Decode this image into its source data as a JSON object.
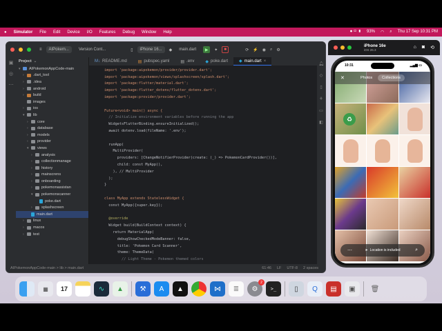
{
  "menubar": {
    "apple": "",
    "items": [
      "Simulator",
      "File",
      "Edit",
      "Device",
      "I/O",
      "Features",
      "Debug",
      "Window",
      "Help"
    ],
    "battery": "93%",
    "clock": "Thu 17 Sep 10:31 PM"
  },
  "ide": {
    "project_name": "AIPokem...",
    "vcs": "Version Cont...",
    "device": "iPhone 16...",
    "run_config": "main.dart",
    "tabs": [
      "README.md",
      "pubspec.yaml",
      ".env",
      "poke.dart",
      "main.dart"
    ],
    "project_label": "Project",
    "tree": [
      {
        "label": "AIPokemonAppCode-main",
        "depth": 0,
        "kind": "folder-blue",
        "arrow": "▾"
      },
      {
        "label": ".dart_tool",
        "depth": 1,
        "kind": "folder-orange",
        "arrow": "›"
      },
      {
        "label": ".idea",
        "depth": 1,
        "kind": "folder",
        "arrow": "›"
      },
      {
        "label": "android",
        "depth": 1,
        "kind": "folder",
        "arrow": "›"
      },
      {
        "label": "build",
        "depth": 1,
        "kind": "folder-orange",
        "arrow": "›"
      },
      {
        "label": "images",
        "depth": 1,
        "kind": "folder",
        "arrow": ""
      },
      {
        "label": "ios",
        "depth": 1,
        "kind": "folder",
        "arrow": "›"
      },
      {
        "label": "lib",
        "depth": 1,
        "kind": "folder",
        "arrow": "▾"
      },
      {
        "label": "core",
        "depth": 2,
        "kind": "folder",
        "arrow": "›"
      },
      {
        "label": "database",
        "depth": 2,
        "kind": "folder",
        "arrow": "›"
      },
      {
        "label": "models",
        "depth": 2,
        "kind": "folder",
        "arrow": "›"
      },
      {
        "label": "provider",
        "depth": 2,
        "kind": "folder",
        "arrow": "›"
      },
      {
        "label": "views",
        "depth": 2,
        "kind": "folder",
        "arrow": "▾"
      },
      {
        "label": "analysis",
        "depth": 3,
        "kind": "folder",
        "arrow": "›"
      },
      {
        "label": "collectionmanage",
        "depth": 3,
        "kind": "folder",
        "arrow": "›"
      },
      {
        "label": "history",
        "depth": 3,
        "kind": "folder",
        "arrow": "›"
      },
      {
        "label": "mainscrens",
        "depth": 3,
        "kind": "folder",
        "arrow": "›"
      },
      {
        "label": "onboarding",
        "depth": 3,
        "kind": "folder",
        "arrow": "›"
      },
      {
        "label": "pokemonassistan",
        "depth": 3,
        "kind": "folder",
        "arrow": "›"
      },
      {
        "label": "pokemonscanner",
        "depth": 3,
        "kind": "folder",
        "arrow": "▾"
      },
      {
        "label": "poke.dart",
        "depth": 4,
        "kind": "dart",
        "arrow": ""
      },
      {
        "label": "splashscreen",
        "depth": 3,
        "kind": "folder",
        "arrow": "›"
      },
      {
        "label": "main.dart",
        "depth": 2,
        "kind": "dart",
        "arrow": "",
        "selected": true
      },
      {
        "label": "linux",
        "depth": 1,
        "kind": "folder",
        "arrow": "›"
      },
      {
        "label": "macos",
        "depth": 1,
        "kind": "folder",
        "arrow": "›"
      },
      {
        "label": "test",
        "depth": 1,
        "kind": "folder",
        "arrow": "›"
      }
    ],
    "code": [
      {
        "n": "",
        "t": "import 'package:aipokemon/provider/provider.dart';"
      },
      {
        "n": "",
        "t": "import 'package:aipokemon/views/splashscreen/splash.dart';"
      },
      {
        "n": "",
        "t": "import 'package:flutter/material.dart';"
      },
      {
        "n": "",
        "t": "import 'package:flutter_dotenv/flutter_dotenv.dart';"
      },
      {
        "n": "",
        "t": "import 'package:provider/provider.dart';"
      },
      {
        "n": "",
        "t": ""
      },
      {
        "n": "",
        "t": "Future<void> main() async {"
      },
      {
        "n": "",
        "t": "  // Initialize environment variables before running the app"
      },
      {
        "n": "",
        "t": "  WidgetsFlutterBinding.ensureInitialized();"
      },
      {
        "n": "",
        "t": "  await dotenv.load(fileName: '.env');"
      },
      {
        "n": "",
        "t": ""
      },
      {
        "n": "",
        "t": "  runApp("
      },
      {
        "n": "",
        "t": "    MultiProvider("
      },
      {
        "n": "",
        "t": "      providers: [ChangeNotifierProvider(create: (_) => PokemonCardProvider())],"
      },
      {
        "n": "",
        "t": "      child: const MyApp(),"
      },
      {
        "n": "",
        "t": "    ), // MultiProvider"
      },
      {
        "n": "",
        "t": "  );"
      },
      {
        "n": "",
        "t": "}"
      },
      {
        "n": "",
        "t": ""
      },
      {
        "n": "",
        "t": "class MyApp extends StatelessWidget {"
      },
      {
        "n": "",
        "t": "  const MyApp({super.key});"
      },
      {
        "n": "",
        "t": ""
      },
      {
        "n": "",
        "t": "  @override"
      },
      {
        "n": "",
        "t": "  Widget build(BuildContext context) {"
      },
      {
        "n": "",
        "t": "    return MaterialApp("
      },
      {
        "n": "",
        "t": "      debugShowCheckedModeBanner: false,"
      },
      {
        "n": "",
        "t": "      title: 'Pokemon Card Scanner',"
      },
      {
        "n": "",
        "t": "      theme: ThemeData("
      },
      {
        "n": "",
        "t": "        // Light Theme - Pokemon themed colors"
      }
    ],
    "status_path": "AIPokemonAppCode-main  >  lib  >  main.dart",
    "status_pos": "61:46",
    "status_lf": "LF",
    "status_enc": "UTF-8",
    "status_indent": "2 spaces"
  },
  "simulator": {
    "device_name": "iPhone 16e",
    "ios_version": "iOS 26.3",
    "phone_time": "10:31",
    "seg_photos": "Photos",
    "seg_collections": "Collections",
    "bottom_text": "Location is included"
  },
  "dock": {
    "apps": [
      "finder-icon",
      "launchpad-icon",
      "calendar-icon",
      "notes-icon",
      "activity-icon",
      "android-studio-icon",
      "xcode-icon",
      "app-store-icon",
      "chrome-icon",
      "vscode-icon",
      "textedit-icon",
      "settings-icon",
      "terminal-icon",
      "simulator-icon",
      "quicktime-icon",
      "pdf-icon",
      "preview-icon",
      "trash-icon"
    ],
    "calendar_day": "17",
    "settings_badge": "2"
  }
}
